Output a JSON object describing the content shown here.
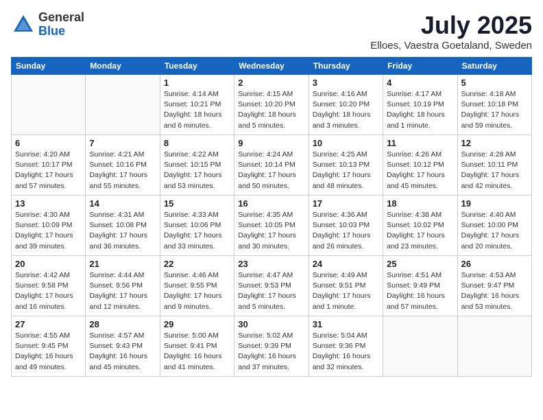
{
  "header": {
    "logo_general": "General",
    "logo_blue": "Blue",
    "month": "July 2025",
    "location": "Elloes, Vaestra Goetaland, Sweden"
  },
  "weekdays": [
    "Sunday",
    "Monday",
    "Tuesday",
    "Wednesday",
    "Thursday",
    "Friday",
    "Saturday"
  ],
  "weeks": [
    [
      {
        "day": "",
        "detail": ""
      },
      {
        "day": "",
        "detail": ""
      },
      {
        "day": "1",
        "detail": "Sunrise: 4:14 AM\nSunset: 10:21 PM\nDaylight: 18 hours\nand 6 minutes."
      },
      {
        "day": "2",
        "detail": "Sunrise: 4:15 AM\nSunset: 10:20 PM\nDaylight: 18 hours\nand 5 minutes."
      },
      {
        "day": "3",
        "detail": "Sunrise: 4:16 AM\nSunset: 10:20 PM\nDaylight: 18 hours\nand 3 minutes."
      },
      {
        "day": "4",
        "detail": "Sunrise: 4:17 AM\nSunset: 10:19 PM\nDaylight: 18 hours\nand 1 minute."
      },
      {
        "day": "5",
        "detail": "Sunrise: 4:18 AM\nSunset: 10:18 PM\nDaylight: 17 hours\nand 59 minutes."
      }
    ],
    [
      {
        "day": "6",
        "detail": "Sunrise: 4:20 AM\nSunset: 10:17 PM\nDaylight: 17 hours\nand 57 minutes."
      },
      {
        "day": "7",
        "detail": "Sunrise: 4:21 AM\nSunset: 10:16 PM\nDaylight: 17 hours\nand 55 minutes."
      },
      {
        "day": "8",
        "detail": "Sunrise: 4:22 AM\nSunset: 10:15 PM\nDaylight: 17 hours\nand 53 minutes."
      },
      {
        "day": "9",
        "detail": "Sunrise: 4:24 AM\nSunset: 10:14 PM\nDaylight: 17 hours\nand 50 minutes."
      },
      {
        "day": "10",
        "detail": "Sunrise: 4:25 AM\nSunset: 10:13 PM\nDaylight: 17 hours\nand 48 minutes."
      },
      {
        "day": "11",
        "detail": "Sunrise: 4:26 AM\nSunset: 10:12 PM\nDaylight: 17 hours\nand 45 minutes."
      },
      {
        "day": "12",
        "detail": "Sunrise: 4:28 AM\nSunset: 10:11 PM\nDaylight: 17 hours\nand 42 minutes."
      }
    ],
    [
      {
        "day": "13",
        "detail": "Sunrise: 4:30 AM\nSunset: 10:09 PM\nDaylight: 17 hours\nand 39 minutes."
      },
      {
        "day": "14",
        "detail": "Sunrise: 4:31 AM\nSunset: 10:08 PM\nDaylight: 17 hours\nand 36 minutes."
      },
      {
        "day": "15",
        "detail": "Sunrise: 4:33 AM\nSunset: 10:06 PM\nDaylight: 17 hours\nand 33 minutes."
      },
      {
        "day": "16",
        "detail": "Sunrise: 4:35 AM\nSunset: 10:05 PM\nDaylight: 17 hours\nand 30 minutes."
      },
      {
        "day": "17",
        "detail": "Sunrise: 4:36 AM\nSunset: 10:03 PM\nDaylight: 17 hours\nand 26 minutes."
      },
      {
        "day": "18",
        "detail": "Sunrise: 4:38 AM\nSunset: 10:02 PM\nDaylight: 17 hours\nand 23 minutes."
      },
      {
        "day": "19",
        "detail": "Sunrise: 4:40 AM\nSunset: 10:00 PM\nDaylight: 17 hours\nand 20 minutes."
      }
    ],
    [
      {
        "day": "20",
        "detail": "Sunrise: 4:42 AM\nSunset: 9:58 PM\nDaylight: 17 hours\nand 16 minutes."
      },
      {
        "day": "21",
        "detail": "Sunrise: 4:44 AM\nSunset: 9:56 PM\nDaylight: 17 hours\nand 12 minutes."
      },
      {
        "day": "22",
        "detail": "Sunrise: 4:46 AM\nSunset: 9:55 PM\nDaylight: 17 hours\nand 9 minutes."
      },
      {
        "day": "23",
        "detail": "Sunrise: 4:47 AM\nSunset: 9:53 PM\nDaylight: 17 hours\nand 5 minutes."
      },
      {
        "day": "24",
        "detail": "Sunrise: 4:49 AM\nSunset: 9:51 PM\nDaylight: 17 hours\nand 1 minute."
      },
      {
        "day": "25",
        "detail": "Sunrise: 4:51 AM\nSunset: 9:49 PM\nDaylight: 16 hours\nand 57 minutes."
      },
      {
        "day": "26",
        "detail": "Sunrise: 4:53 AM\nSunset: 9:47 PM\nDaylight: 16 hours\nand 53 minutes."
      }
    ],
    [
      {
        "day": "27",
        "detail": "Sunrise: 4:55 AM\nSunset: 9:45 PM\nDaylight: 16 hours\nand 49 minutes."
      },
      {
        "day": "28",
        "detail": "Sunrise: 4:57 AM\nSunset: 9:43 PM\nDaylight: 16 hours\nand 45 minutes."
      },
      {
        "day": "29",
        "detail": "Sunrise: 5:00 AM\nSunset: 9:41 PM\nDaylight: 16 hours\nand 41 minutes."
      },
      {
        "day": "30",
        "detail": "Sunrise: 5:02 AM\nSunset: 9:39 PM\nDaylight: 16 hours\nand 37 minutes."
      },
      {
        "day": "31",
        "detail": "Sunrise: 5:04 AM\nSunset: 9:36 PM\nDaylight: 16 hours\nand 32 minutes."
      },
      {
        "day": "",
        "detail": ""
      },
      {
        "day": "",
        "detail": ""
      }
    ]
  ]
}
